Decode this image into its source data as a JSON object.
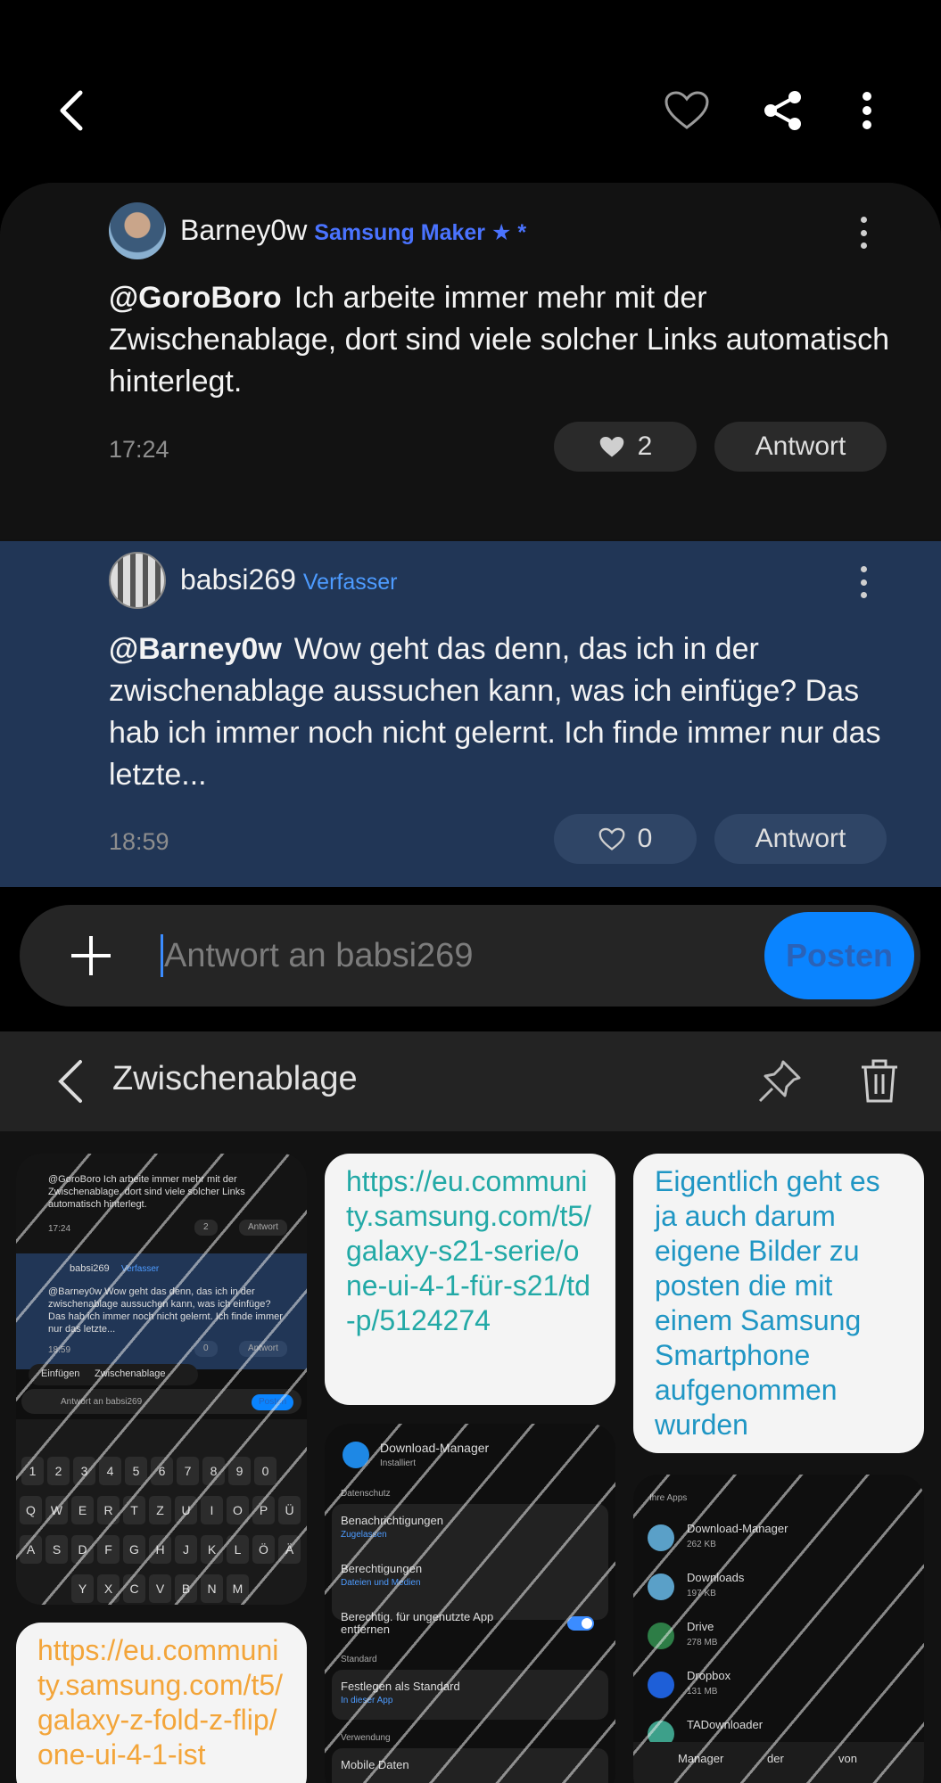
{
  "appbar": {
    "back_icon": "back-arrow-icon",
    "favorite_icon": "heart-outline-icon",
    "share_icon": "share-icon",
    "more_icon": "more-vertical-icon"
  },
  "comments": [
    {
      "username": "Barney0w",
      "badge": "Samsung Maker ★ *",
      "mention": "@GoroBoro",
      "text": "Ich arbeite immer mehr mit der Zwischenablage, dort sind viele solcher Links automatisch hinterlegt.",
      "time": "17:24",
      "likes": "2",
      "liked": true,
      "reply_label": "Antwort"
    },
    {
      "username": "babsi269",
      "badge": "Verfasser",
      "mention": "@Barney0w",
      "text": "Wow geht das denn, das ich in der zwischenablage aussuchen kann, was ich einfüge? Das hab ich immer noch nicht gelernt. Ich finde immer nur das letzte...",
      "time": "18:59",
      "likes": "0",
      "liked": false,
      "reply_label": "Antwort"
    }
  ],
  "composer": {
    "placeholder": "Antwort an babsi269",
    "post_label": "Posten",
    "accent": "#0a84ff"
  },
  "clipboard": {
    "title": "Zwischenablage",
    "link1": "https://eu.community.samsung.com/t5/galaxy-s21-serie/one-ui-4-1-für-s21/td-p/5124274",
    "text1": "Eigentlich geht es ja auch darum eigene Bilder zu posten die mit einem Samsung Smartphone aufgenommen wurden",
    "link2": "https://eu.community.samsung.com/t5/galaxy-z-fold-z-flip/one-ui-4-1-ist",
    "shot1": {
      "lines": [
        "@GoroBoro  Ich arbeite immer mehr mit der",
        "Zwischenablage, dort sind viele solcher Links",
        "automatisch hinterlegt."
      ],
      "time1": "17:24",
      "likes1": "2",
      "reply": "Antwort",
      "user2": "babsi269",
      "badge2": "Verfasser",
      "lines2": [
        "@Barney0w  Wow geht das denn, das ich in der",
        "zwischenablage aussuchen kann, was ich einfüge?",
        "Das hab ich immer noch nicht gelernt. Ich finde immer",
        "nur das letzte..."
      ],
      "time2": "18:59",
      "likes2": "0",
      "menu1": "Einfügen",
      "menu2": "Zwischenablage",
      "placeholder": "Antwort an babsi269",
      "post": "Posten",
      "row_num": [
        "1",
        "2",
        "3",
        "4",
        "5",
        "6",
        "7",
        "8",
        "9",
        "0"
      ],
      "row_q": [
        "Q",
        "W",
        "E",
        "R",
        "T",
        "Z",
        "U",
        "I",
        "O",
        "P",
        "Ü"
      ],
      "row_a": [
        "A",
        "S",
        "D",
        "F",
        "G",
        "H",
        "J",
        "K",
        "L",
        "Ö",
        "Ä"
      ],
      "row_y": [
        "Y",
        "X",
        "C",
        "V",
        "B",
        "N",
        "M"
      ]
    },
    "shot2": {
      "app": "Download-Manager",
      "state": "Installiert",
      "sec1": "Datenschutz",
      "r1": "Benachrichtigungen",
      "r1s": "Zugelassen",
      "r2": "Berechtigungen",
      "r2s": "Dateien und Medien",
      "r3": "Berechtig. für ungenutzte App entfernen",
      "sec2": "Standard",
      "r4": "Festlegen als Standard",
      "r4s": "In dieser App",
      "sec3": "Verwendung",
      "r5": "Mobile Daten"
    },
    "shot3": {
      "header": "Ihre Apps",
      "apps": [
        {
          "name": "Download-Manager",
          "size": "262 KB"
        },
        {
          "name": "Downloads",
          "size": "197 KB"
        },
        {
          "name": "Drive",
          "size": "278 MB"
        },
        {
          "name": "Dropbox",
          "size": "131 MB"
        },
        {
          "name": "TADownloader",
          "size": ""
        }
      ],
      "kb": [
        "Manager",
        "der",
        "von"
      ]
    }
  }
}
